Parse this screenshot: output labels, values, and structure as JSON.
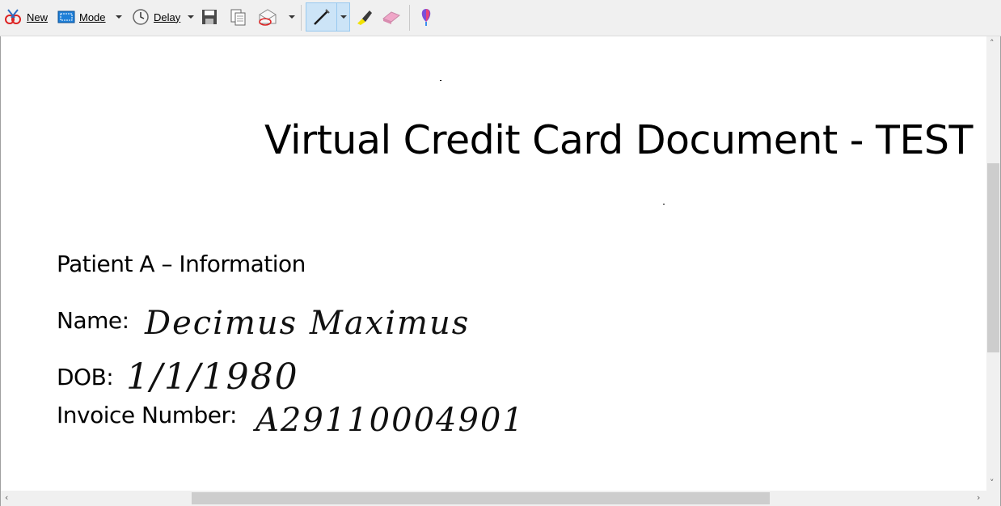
{
  "toolbar": {
    "new_label": "New",
    "mode_label": "Mode",
    "delay_label": "Delay",
    "icons": [
      "new-snip-icon",
      "mode-icon",
      "delay-clock-icon",
      "save-icon",
      "copy-icon",
      "send-email-icon",
      "pen-icon",
      "highlighter-icon",
      "eraser-icon",
      "paint3d-icon"
    ]
  },
  "document": {
    "title": "Virtual Credit Card Document - TEST",
    "section_heading": "Patient A – Information",
    "fields": [
      {
        "label": "Name:",
        "value": "Decimus  Maximus"
      },
      {
        "label": "DOB:",
        "value": "1/1/1980"
      },
      {
        "label": "Invoice Number:",
        "value": "A29110004901"
      }
    ]
  },
  "colors": {
    "toolbar_bg": "#f0f0f0",
    "active_tool_bg": "#cce4f7",
    "scroll_thumb": "#cdcdcd"
  }
}
